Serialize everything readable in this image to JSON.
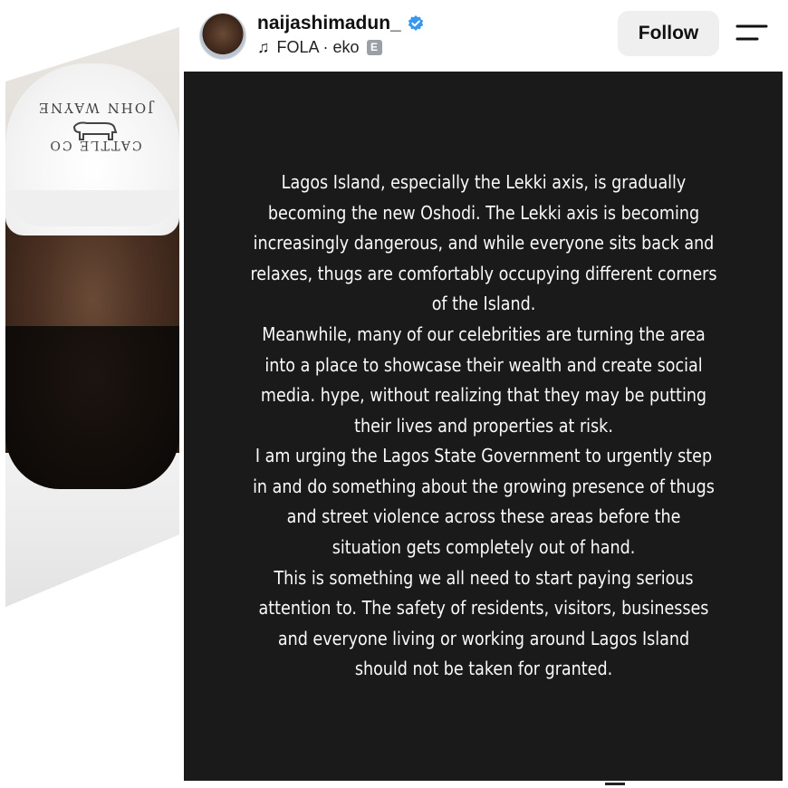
{
  "profile": {
    "username": "naijashimadun_",
    "verified": true,
    "music_track": "FOLA · eko",
    "explicit_badge": "E"
  },
  "actions": {
    "follow_label": "Follow",
    "menu_icon": "menu-icon"
  },
  "photo": {
    "cap_text_top": "JOHN WAYNE",
    "cap_text_bottom": "CATTLE CO"
  },
  "story": {
    "paragraphs": [
      "Lagos Island, especially the Lekki axis, is gradually becoming the new Oshodi. The Lekki axis is becoming increasingly dangerous, and while everyone sits back and relaxes, thugs are comfortably occupying different corners of the Island.",
      "Meanwhile, many of our celebrities are turning the area into a place to showcase their wealth and create social media. hype, without realizing that they may be putting their lives and properties at risk.",
      "I am urging the Lagos State Government to urgently step in and do something about the growing presence of thugs and street violence across these areas before the situation gets completely out of hand.",
      "This is something we all need to start paying serious attention to. The safety of residents, visitors, businesses and everyone living or working around Lagos Island should not be taken for granted."
    ],
    "background_color": "#1a1a1a",
    "text_color": "#fafafa"
  },
  "colors": {
    "verified_blue": "#3897f0",
    "follow_bg": "#efefef"
  }
}
